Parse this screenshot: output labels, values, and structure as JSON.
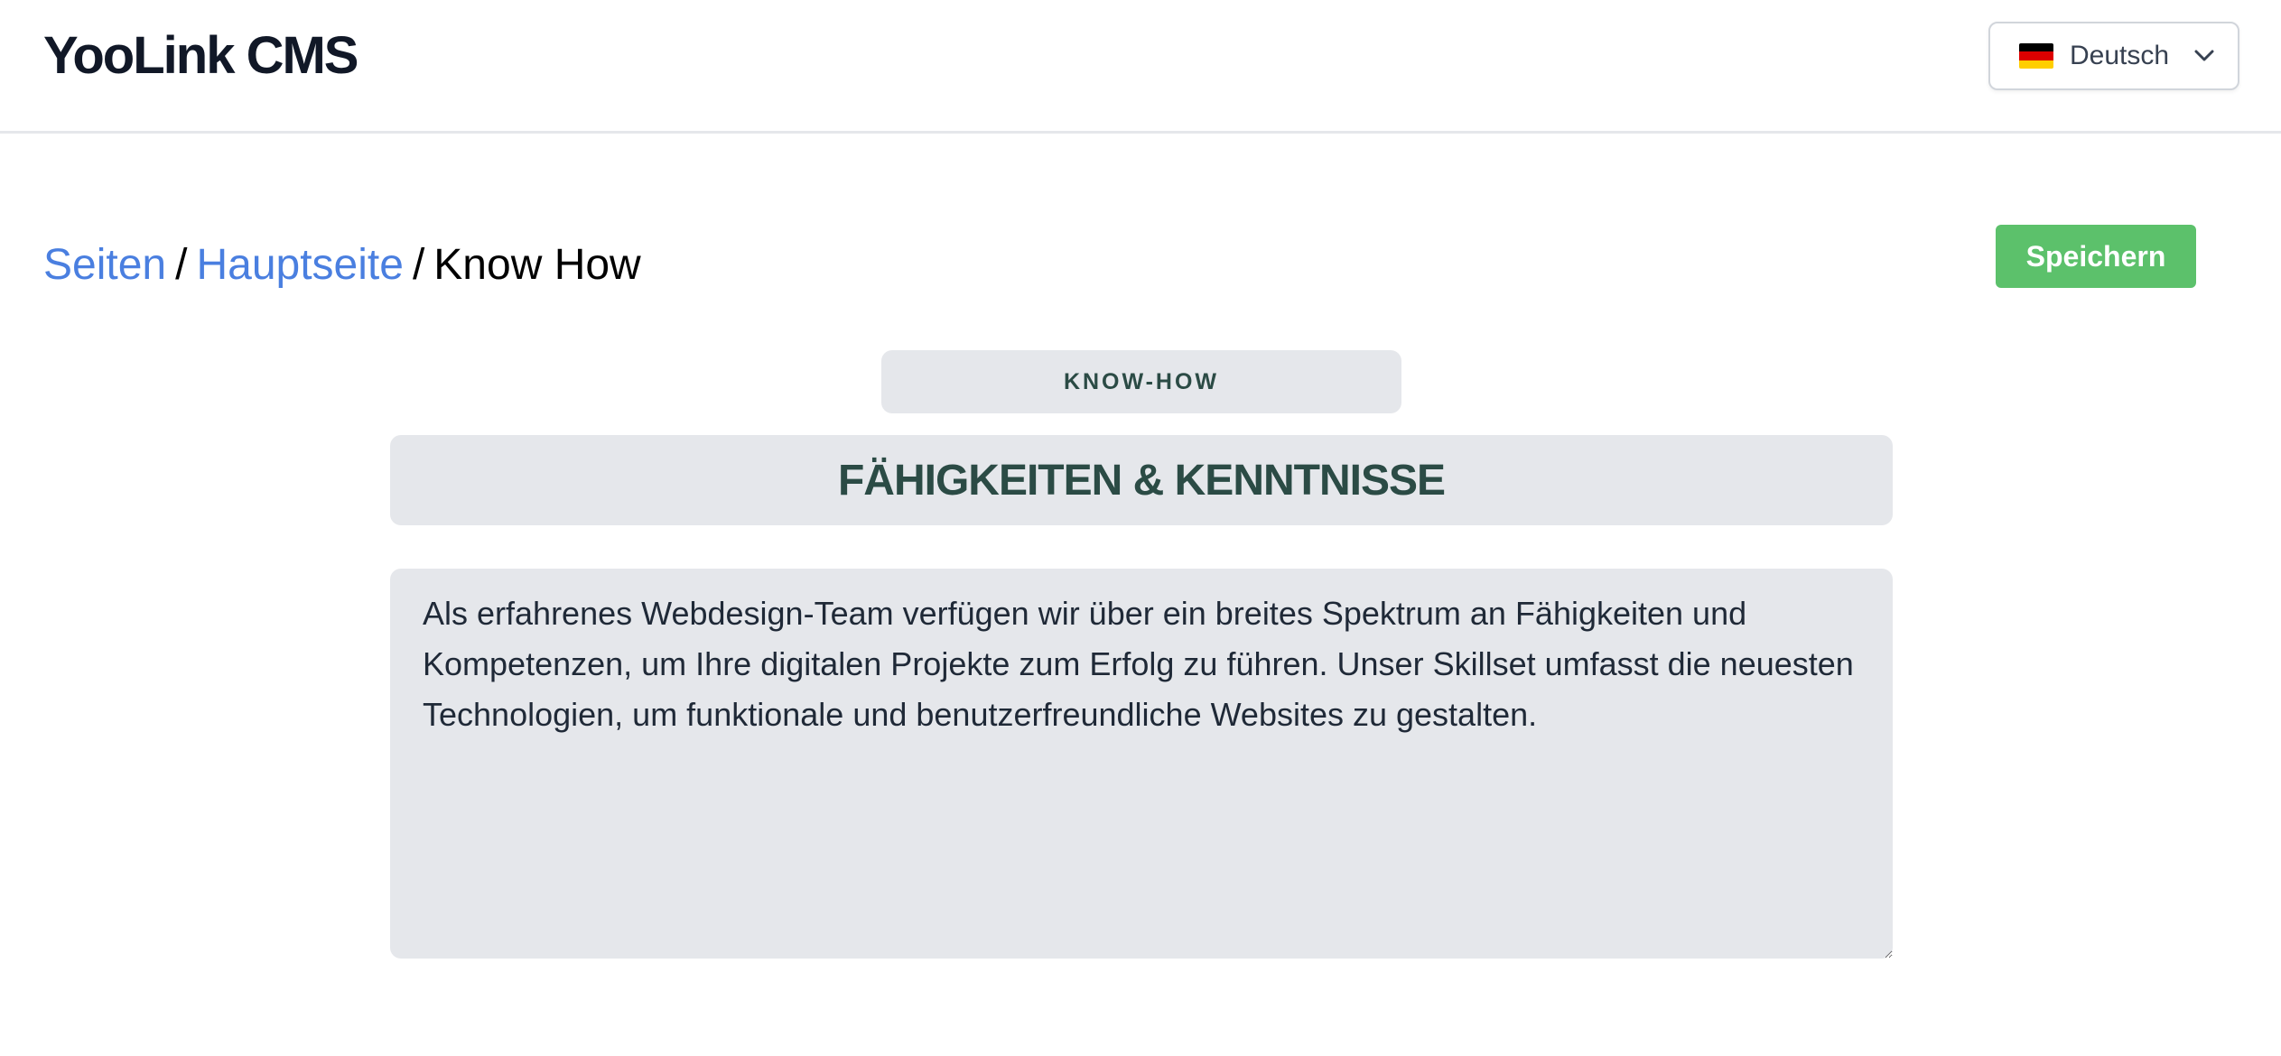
{
  "app": {
    "title": "YooLink CMS"
  },
  "language": {
    "selected": "Deutsch",
    "flag_icon": "germany-flag-icon",
    "flag_colors": [
      "#000000",
      "#dd0000",
      "#ffce00"
    ]
  },
  "breadcrumb": {
    "items": [
      {
        "label": "Seiten",
        "link": true
      },
      {
        "label": "Hauptseite",
        "link": true
      },
      {
        "label": "Know How",
        "link": false
      }
    ],
    "separator": "/"
  },
  "toolbar": {
    "save_label": "Speichern"
  },
  "section": {
    "subtitle": "KNOW-HOW",
    "title": "FÄHIGKEITEN & KENNTNISSE",
    "description": "Als erfahrenes Webdesign-Team verfügen wir über ein breites Spektrum an Fähigkeiten und Kompetenzen, um Ihre digitalen Projekte zum Erfolg zu führen. Unser Skillset umfasst die neuesten Technologien, um funktionale und benutzerfreundliche Websites zu gestalten."
  },
  "colors": {
    "link": "#4a7fe0",
    "save_button": "#5cc16b",
    "heading_text": "#2b4b45",
    "field_background": "#e5e7eb"
  }
}
